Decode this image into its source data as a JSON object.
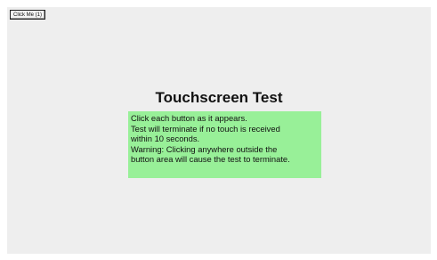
{
  "click_button": {
    "label": "Click Me (1)"
  },
  "test": {
    "title": "Touchscreen Test",
    "instructions": [
      "Click each button as it appears.",
      "Test will terminate if no touch is received",
      "within 10 seconds.",
      "Warning: Clicking anywhere outside the",
      "button area will cause the test to terminate."
    ]
  },
  "colors": {
    "screen_background": "#eeeeee",
    "instruction_background": "#98f098"
  }
}
